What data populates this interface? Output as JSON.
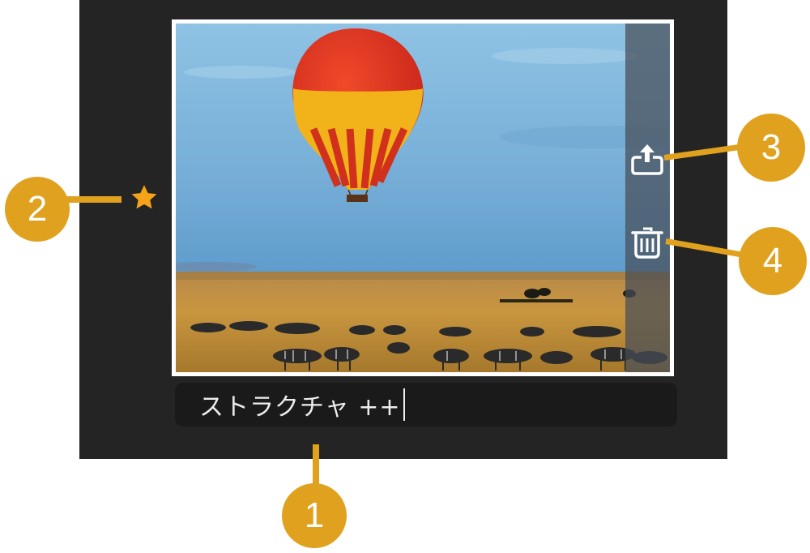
{
  "photo": {
    "subject": "hot air balloon over savanna with zebras",
    "sky_color": "#7bb0d6",
    "balloon_colors": [
      "#e8361f",
      "#f2b21a"
    ],
    "grass_color": "#c9963f"
  },
  "actions": [
    {
      "name": "share",
      "icon": "share-icon"
    },
    {
      "name": "delete",
      "icon": "trash-icon"
    }
  ],
  "favorite": {
    "icon": "star-icon",
    "color": "#f5a318",
    "active": true
  },
  "caption": {
    "value": "ストラクチャ ++"
  },
  "callouts": {
    "caption": "1",
    "favorite": "2",
    "share": "3",
    "delete": "4"
  },
  "colors": {
    "panel": "#242424",
    "caption_bg": "#1a1a1a",
    "callout": "#e0a21e"
  }
}
